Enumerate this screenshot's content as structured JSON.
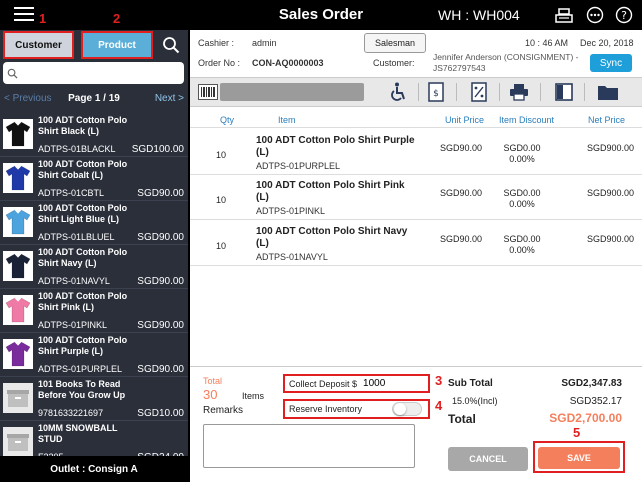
{
  "header": {
    "title": "Sales Order",
    "warehouse": "WH : WH004"
  },
  "left_panel": {
    "tabs": {
      "customer": "Customer",
      "product": "Product"
    },
    "search": {
      "placeholder": ""
    },
    "pager": {
      "previous": "< Previous",
      "page": "Page 1 / 19",
      "next": "Next >"
    },
    "products": [
      {
        "name": "100 ADT Cotton Polo Shirt Black (L)",
        "sku": "ADTPS-01BLACKL",
        "price": "SGD100.00",
        "color": "#111111",
        "icon": "polo-shirt-icon"
      },
      {
        "name": "100 ADT Cotton Polo Shirt Cobalt (L)",
        "sku": "ADTPS-01CBTL",
        "price": "SGD90.00",
        "color": "#1f3aa8",
        "icon": "polo-shirt-icon"
      },
      {
        "name": "100 ADT Cotton Polo Shirt Light Blue (L)",
        "sku": "ADTPS-01LBLUEL",
        "price": "SGD90.00",
        "color": "#4da3de",
        "icon": "polo-shirt-icon"
      },
      {
        "name": "100 ADT Cotton Polo Shirt Navy (L)",
        "sku": "ADTPS-01NAVYL",
        "price": "SGD90.00",
        "color": "#1a2237",
        "icon": "polo-shirt-icon"
      },
      {
        "name": "100 ADT Cotton Polo Shirt Pink (L)",
        "sku": "ADTPS-01PINKL",
        "price": "SGD90.00",
        "color": "#f07aa6",
        "icon": "polo-shirt-icon"
      },
      {
        "name": "100 ADT Cotton Polo Shirt Purple (L)",
        "sku": "ADTPS-01PURPLEL",
        "price": "SGD90.00",
        "color": "#7a2b9c",
        "icon": "polo-shirt-icon"
      },
      {
        "name": "101 Books To Read Before You Grow Up",
        "sku": "9781633221697",
        "price": "SGD10.00",
        "color": "#bfbfbf",
        "icon": "box-placeholder-icon"
      },
      {
        "name": "10MM SNOWBALL STUD",
        "sku": "F2205",
        "price": "SGD24.00",
        "color": "#bfbfbf",
        "icon": "box-placeholder-icon"
      }
    ],
    "outlet": "Outlet : Consign A"
  },
  "order_info": {
    "cashier_label": "Cashier :",
    "cashier": "admin",
    "salesman_label": "Salesman",
    "time": "10 : 46 AM",
    "date": "Dec 20, 2018",
    "order_no_label": "Order No :",
    "order_no": "CON-AQ0000003",
    "customer_label": "Customer:",
    "customer_line1": "Jennifer Anderson (CONSIGNMENT) -",
    "customer_line2": "JS762797543",
    "sync_label": "Sync"
  },
  "cart": {
    "columns": {
      "qty": "Qty",
      "item": "Item",
      "unit_price": "Unit Price",
      "discount": "Item Discount",
      "net_price": "Net Price"
    },
    "rows": [
      {
        "qty": "10",
        "name": "100 ADT Cotton Polo Shirt Purple (L)",
        "sku": "ADTPS-01PURPLEL",
        "unit_price": "SGD90.00",
        "discount_amount": "SGD0.00",
        "discount_pct": "0.00%",
        "net_price": "SGD900.00"
      },
      {
        "qty": "10",
        "name": "100 ADT Cotton Polo Shirt Pink (L)",
        "sku": "ADTPS-01PINKL",
        "unit_price": "SGD90.00",
        "discount_amount": "SGD0.00",
        "discount_pct": "0.00%",
        "net_price": "SGD900.00"
      },
      {
        "qty": "10",
        "name": "100 ADT Cotton Polo Shirt Navy (L)",
        "sku": "ADTPS-01NAVYL",
        "unit_price": "SGD90.00",
        "discount_amount": "SGD0.00",
        "discount_pct": "0.00%",
        "net_price": "SGD900.00"
      }
    ]
  },
  "summary": {
    "total_label": "Total",
    "total_count": "30",
    "items_label": "Items",
    "remarks_label": "Remarks",
    "remarks_value": "",
    "deposit_label": "Collect Deposit $",
    "deposit_value": "1000",
    "reserve_label": "Reserve Inventory",
    "reserve_on": false,
    "subtotal_label": "Sub Total",
    "subtotal": "SGD2,347.83",
    "tax_label": "15.0%(Incl)",
    "tax": "SGD352.17",
    "grand_label": "Total",
    "grand_total": "SGD2,700.00",
    "cancel_label": "CANCEL",
    "save_label": "SAVE"
  },
  "annotations": {
    "n1": "1",
    "n2": "2",
    "n3": "3",
    "n4": "4",
    "n5": "5"
  },
  "colors": {
    "accent_blue": "#1f9fd9",
    "tab_blue": "#5aaed8",
    "annotation_red": "#e02020",
    "save_orange": "#f47f5c",
    "total_orange": "#f47f5c",
    "panel_dark": "#2b2f3a"
  }
}
